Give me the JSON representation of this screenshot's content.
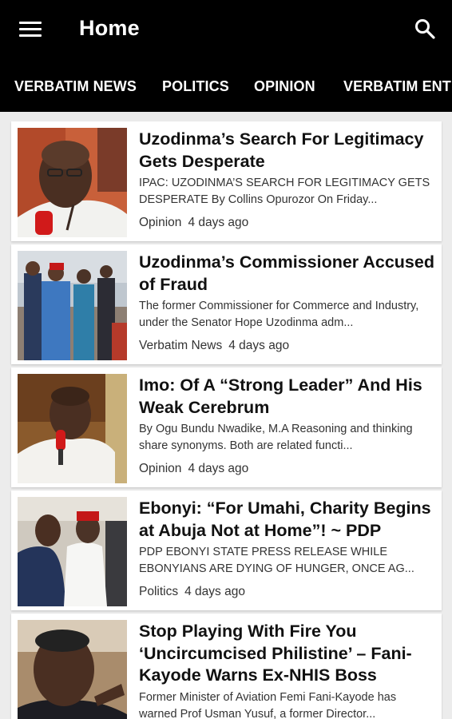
{
  "appbar": {
    "title": "Home"
  },
  "tabs": [
    "VERBATIM NEWS",
    "POLITICS",
    "OPINION",
    "VERBATIM ENTERTAINMENT"
  ],
  "articles": [
    {
      "title": "Uzodinma’s Search For Legitimacy Gets Desperate",
      "excerpt": "IPAC: UZODINMA’S SEARCH FOR LEGITIMACY GETS DESPERATE By Collins Opurozor On Friday...",
      "category": "Opinion",
      "time": "4 days ago"
    },
    {
      "title": "Uzodinma’s Commissioner Accused of Fraud",
      "excerpt": "The former Commissioner for Commerce and Industry, under the Senator Hope Uzodinma adm...",
      "category": "Verbatim News",
      "time": "4 days ago"
    },
    {
      "title": "Imo: Of A “Strong Leader” And His Weak Cerebrum",
      "excerpt": "By Ogu Bundu Nwadike, M.A Reasoning and thinking share synonyms. Both are related functi...",
      "category": "Opinion",
      "time": "4 days ago"
    },
    {
      "title": "Ebonyi: “For Umahi, Charity Begins at Abuja Not at Home”! ~ PDP",
      "excerpt": "PDP EBONYI STATE PRESS RELEASE WHILE EBONYIANS ARE DYING OF HUNGER, ONCE AG...",
      "category": "Politics",
      "time": "4 days ago"
    },
    {
      "title": "Stop Playing With Fire You ‘Uncircumcised Philistine’ – Fani-Kayode Warns Ex-NHIS Boss",
      "excerpt": "Former Minister of Aviation Femi Fani-Kayode has warned Prof Usman Yusuf, a former Director...",
      "category": "",
      "time": ""
    }
  ]
}
